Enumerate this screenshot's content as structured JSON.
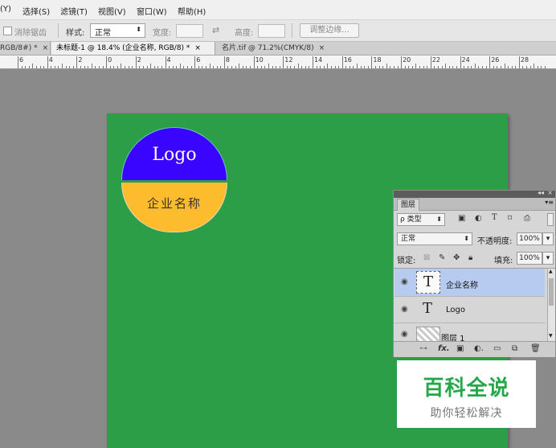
{
  "menu": {
    "items": [
      "(Y)",
      "选择(S)",
      "滤镜(T)",
      "视图(V)",
      "窗口(W)",
      "帮助(H)"
    ]
  },
  "options": {
    "antialias_label": "消除锯齿",
    "style_label": "样式:",
    "style_value": "正常",
    "width_label": "宽度:",
    "height_label": "高度:",
    "refine_edge_button": "调整边缘..."
  },
  "tabs": [
    {
      "label": "RGB/8#) *",
      "close": "×"
    },
    {
      "label": "未标题-1 @ 18.4% (企业名称, RGB/8) *",
      "close": "×"
    },
    {
      "label": "名片.tif @ 71.2%(CMYK/8)",
      "close": "×"
    }
  ],
  "ruler": {
    "labels": [
      "6",
      "4",
      "2",
      "0",
      "2",
      "4",
      "6",
      "8",
      "10",
      "12",
      "14",
      "16",
      "18",
      "20",
      "22",
      "24",
      "26",
      "28"
    ]
  },
  "canvas": {
    "background_color": "#2c9e48",
    "logo_text": "Logo",
    "company_text": "企业名称",
    "logo_top_color": "#3a05ff",
    "logo_bottom_color": "#fdbc2d"
  },
  "layers_panel": {
    "tab_label": "图层",
    "filter_label": "ρ 类型",
    "blend_mode": "正常",
    "opacity_label": "不透明度:",
    "opacity_value": "100%",
    "lock_label": "锁定:",
    "fill_label": "填充:",
    "fill_value": "100%",
    "layers": [
      {
        "name": "企业名称",
        "type": "text",
        "thumb": "T",
        "selected": true
      },
      {
        "name": "Logo",
        "type": "text",
        "thumb": "T",
        "selected": false
      },
      {
        "name": "图层 1",
        "type": "raster",
        "thumb": "",
        "selected": false
      }
    ],
    "footer_icons": [
      "link-icon",
      "fx-icon",
      "mask-icon",
      "adjustment-icon",
      "group-folder-icon",
      "new-layer-icon",
      "trash-icon"
    ],
    "footer_fx": "fx."
  },
  "watermark": {
    "title": "百科全说",
    "subtitle": "助你轻松解决",
    "color": "#26a84a"
  }
}
